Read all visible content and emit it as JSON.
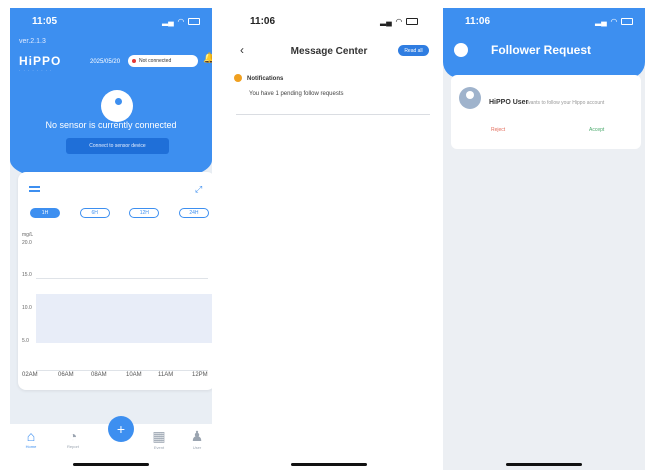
{
  "screen1": {
    "status_time": "11:05",
    "version": "ver.2.1.3",
    "brand": "HiPPO",
    "brand_sub": "· · · · · · · ·",
    "date": "2025/05/20",
    "sensor_pill": "Not connected",
    "no_sensor_text": "No sensor is currently connected",
    "connect_button": "Connect to sensor device",
    "ranges": [
      "1H",
      "6H",
      "12H",
      "24H"
    ],
    "active_range": 0,
    "y_unit": "mg/L",
    "y_ticks": [
      "20.0",
      "15.0",
      "10.0",
      "5.0"
    ],
    "x_ticks": [
      "02AM",
      "06AM",
      "08AM",
      "10AM",
      "11AM",
      "12PM"
    ],
    "tabs": [
      {
        "label": "Home",
        "icon": "home-icon"
      },
      {
        "label": "Report",
        "icon": "pie-chart-icon"
      },
      {
        "label": "Event",
        "icon": "calendar-icon"
      },
      {
        "label": "User",
        "icon": "user-icon"
      }
    ],
    "fab_label": "+"
  },
  "screen2": {
    "status_time": "11:06",
    "title": "Message Center",
    "read_all": "Read all",
    "notif_title": "Notifications",
    "notif_text": "You have 1 pending follow requests"
  },
  "screen3": {
    "status_time": "11:06",
    "title": "Follower Request",
    "user_name": "HiPPO User",
    "user_message": "wants to follow your Hippo account",
    "reject": "Reject",
    "accept": "Accept"
  },
  "colors": {
    "primary": "#3d8ff0",
    "primary_dark": "#1f6fd8",
    "alert": "#ff3b30",
    "notif": "#f0a020",
    "reject": "#e36b5a",
    "accept": "#4aa96c"
  }
}
